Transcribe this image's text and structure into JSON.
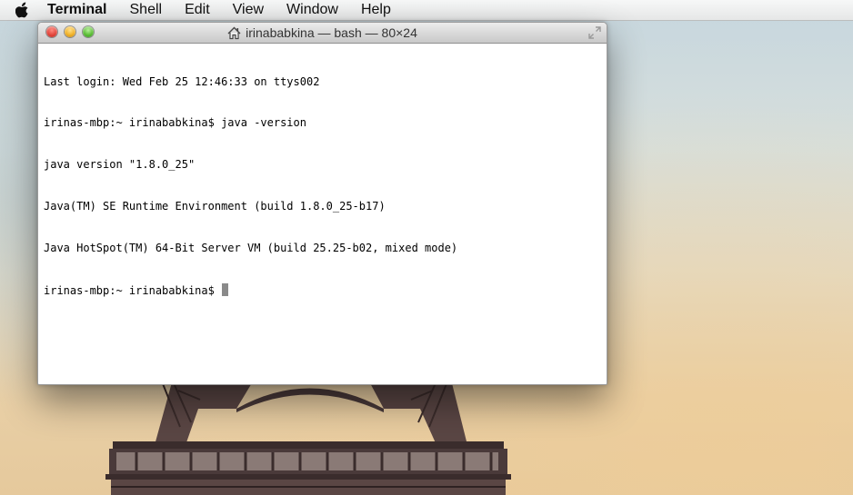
{
  "menubar": {
    "apple_icon": "apple-icon",
    "items": [
      "Terminal",
      "Shell",
      "Edit",
      "View",
      "Window",
      "Help"
    ]
  },
  "window": {
    "title": "irinababkina — bash — 80×24",
    "title_icon": "home-icon",
    "lines": [
      "Last login: Wed Feb 25 12:46:33 on ttys002",
      "irinas-mbp:~ irinababkina$ java -version",
      "java version \"1.8.0_25\"",
      "Java(TM) SE Runtime Environment (build 1.8.0_25-b17)",
      "Java HotSpot(TM) 64-Bit Server VM (build 25.25-b02, mixed mode)"
    ],
    "prompt": "irinas-mbp:~ irinababkina$ "
  },
  "colors": {
    "close": "#e2463c",
    "minimize": "#f0b128",
    "zoom": "#5bbd35",
    "tower": "#4a3a3a"
  }
}
